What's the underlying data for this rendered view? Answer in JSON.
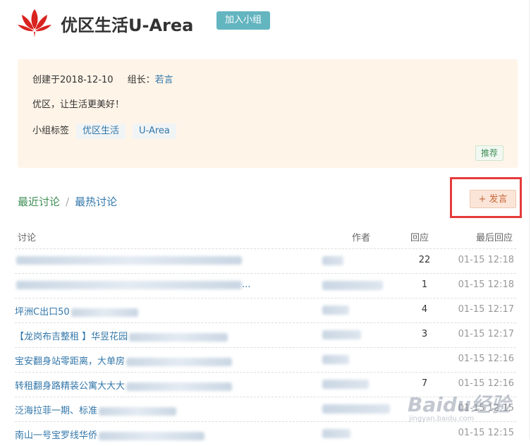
{
  "group": {
    "title": "优区生活U-Area",
    "join_label": "加入小组"
  },
  "info": {
    "created": "创建于2018-12-10",
    "leader_prefix": "组长：",
    "leader_name": "若言",
    "description": "优区，让生活更美好！",
    "tags_label": "小组标签",
    "tags": [
      "优区生活",
      "U-Area"
    ],
    "recommend_label": "推荐"
  },
  "tabs": {
    "recent": "最近讨论",
    "separator": "/",
    "hot": "最热讨论"
  },
  "post_button": "+ 发言",
  "table": {
    "headers": {
      "topic": "讨论",
      "author": "作者",
      "replies": "回应",
      "last": "最后回应"
    },
    "rows": [
      {
        "topic": "",
        "replies": "22",
        "last": "01-15 12:18"
      },
      {
        "topic": "...",
        "replies": "1",
        "last": "01-15 12:18"
      },
      {
        "topic": "坪洲C出口50",
        "replies": "4",
        "last": "01-15 12:17"
      },
      {
        "topic": "【龙岗布吉整租 】华昱花园",
        "replies": "3",
        "last": "01-15 12:17"
      },
      {
        "topic": "宝安翻身站零距离，大单房",
        "replies": "",
        "last": "01-15 12:16"
      },
      {
        "topic": "转租翻身路精装公寓大大大",
        "replies": "7",
        "last": "01-15 12:16"
      },
      {
        "topic": "泛海拉菲一期、标准",
        "replies": "",
        "last": "01-15 12:15"
      },
      {
        "topic": "南山一号宝罗线华侨",
        "replies": "",
        "last": "01-15 12:15"
      }
    ]
  },
  "watermark": {
    "main": "Baidu经验",
    "sub": "jingyan.baidu.com"
  },
  "colors": {
    "accent_green": "#3e8e55",
    "link_blue": "#3377aa",
    "join_teal": "#63b5c0",
    "info_bg": "#fff4e8",
    "highlight_red": "#e63a3a"
  }
}
